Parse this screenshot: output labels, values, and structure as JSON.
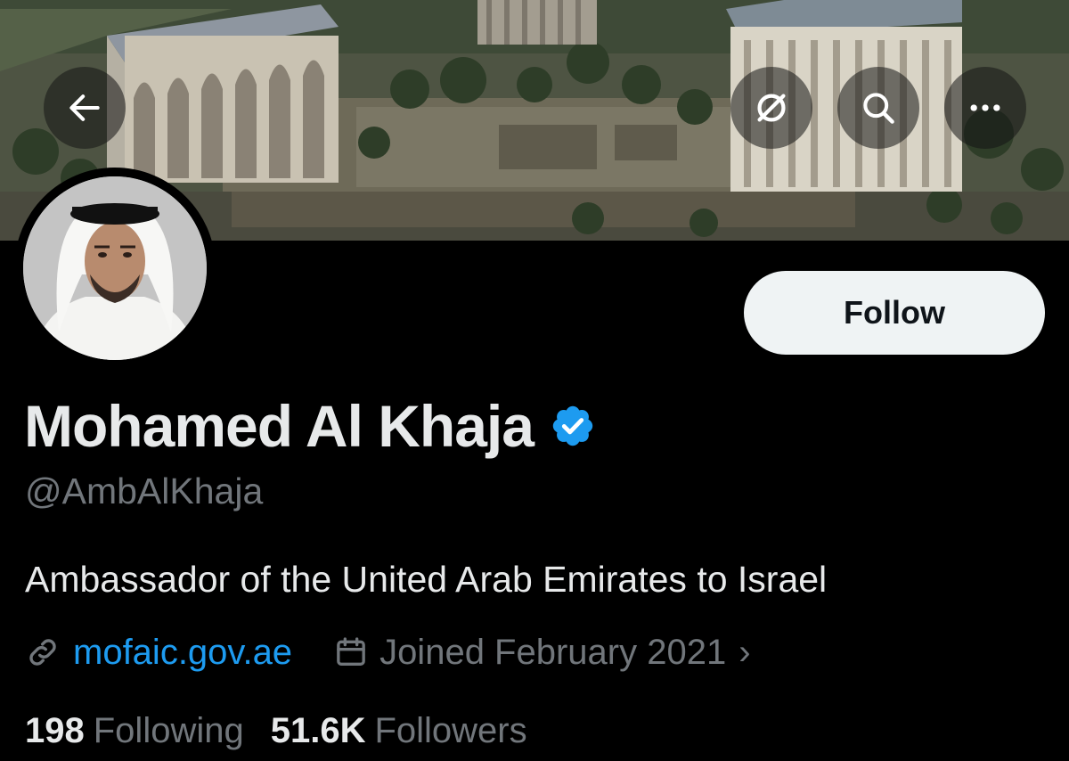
{
  "header": {
    "back_icon": "arrow-left-icon",
    "translate_icon": "translate-icon",
    "search_icon": "search-icon",
    "more_icon": "more-horizontal-icon"
  },
  "profile": {
    "name": "Mohamed Al Khaja",
    "verified": true,
    "verified_color": "#1d9bf0",
    "handle": "@AmbAlKhaja",
    "bio": "Ambassador of the United Arab Emirates to Israel",
    "website": "mofaic.gov.ae",
    "joined": "Joined February 2021",
    "following_count": "198",
    "following_label": "Following",
    "followers_count": "51.6K",
    "followers_label": "Followers"
  },
  "actions": {
    "follow_label": "Follow"
  },
  "colors": {
    "background": "#000000",
    "text": "#e7e9ea",
    "muted": "#71767b",
    "link": "#1d9bf0",
    "follow_bg": "#eff3f4"
  }
}
